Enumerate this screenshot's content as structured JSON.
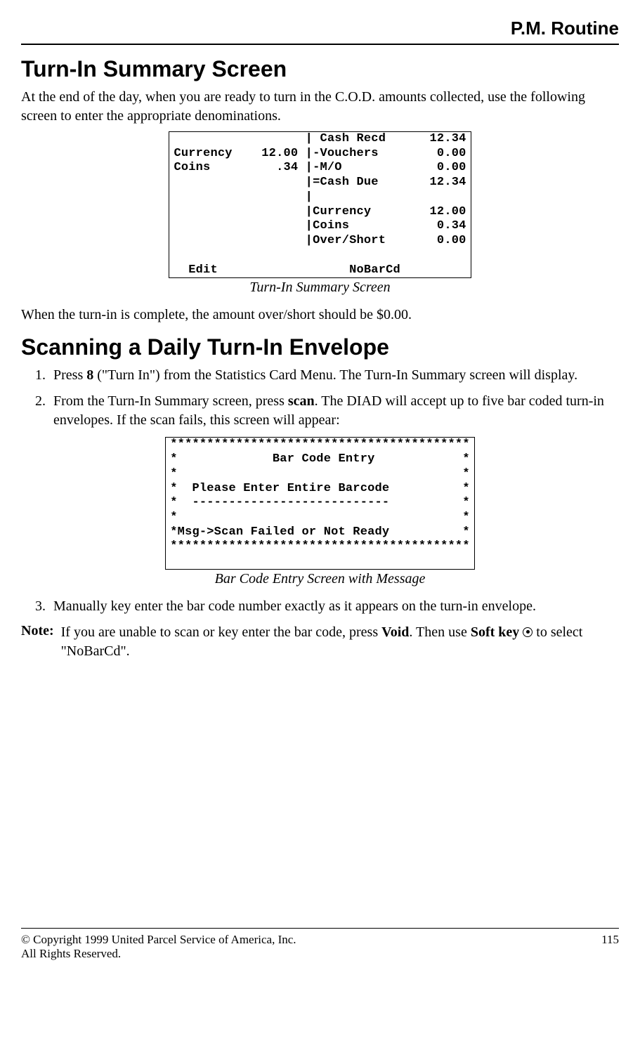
{
  "header": {
    "section_title": "P.M. Routine"
  },
  "section1": {
    "heading": "Turn-In Summary Screen",
    "intro": "At the end of the day, when you are ready to turn in the C.O.D. amounts collected, use the following screen to enter the appropriate denominations.",
    "screen": "                  | Cash Recd      12.34\nCurrency    12.00 |-Vouchers        0.00\nCoins         .34 |-M/O             0.00\n                  |=Cash Due       12.34\n                  |\n                  |Currency        12.00\n                  |Coins            0.34\n                  |Over/Short       0.00\n\n  Edit                  NoBarCd",
    "caption": "Turn-In Summary Screen",
    "after": "When the turn-in is complete, the amount over/short should be $0.00."
  },
  "section2": {
    "heading": "Scanning a Daily Turn-In Envelope",
    "step1_a": "Press ",
    "step1_key": "8",
    "step1_b": " (\"Turn In\") from the Statistics Card Menu. The Turn-In Summary screen will display.",
    "step2_a": "From the Turn-In Summary screen, press ",
    "step2_key": "scan",
    "step2_b": ". The DIAD will accept up to five bar coded turn-in envelopes. If the scan fails, this screen will appear:",
    "screen": "*****************************************\n*             Bar Code Entry            *\n*                                       *\n*  Please Enter Entire Barcode          *\n*  ---------------------------          *\n*                                       *\n*Msg->Scan Failed or Not Ready          *\n*****************************************\n\n",
    "caption": "Bar Code Entry Screen with Message",
    "step3": "Manually key enter the bar code number exactly as it appears on the turn-in envelope.",
    "note_label": "Note:",
    "note_a": "If you are unable to scan or key enter the bar code, press ",
    "note_void": "Void",
    "note_b": ". Then use ",
    "note_softkey": "Soft key",
    "note_c": " to select \"NoBarCd\"."
  },
  "footer": {
    "copyright": "© Copyright 1999 United Parcel Service of America, Inc.",
    "rights": "All Rights Reserved.",
    "page": "115"
  }
}
